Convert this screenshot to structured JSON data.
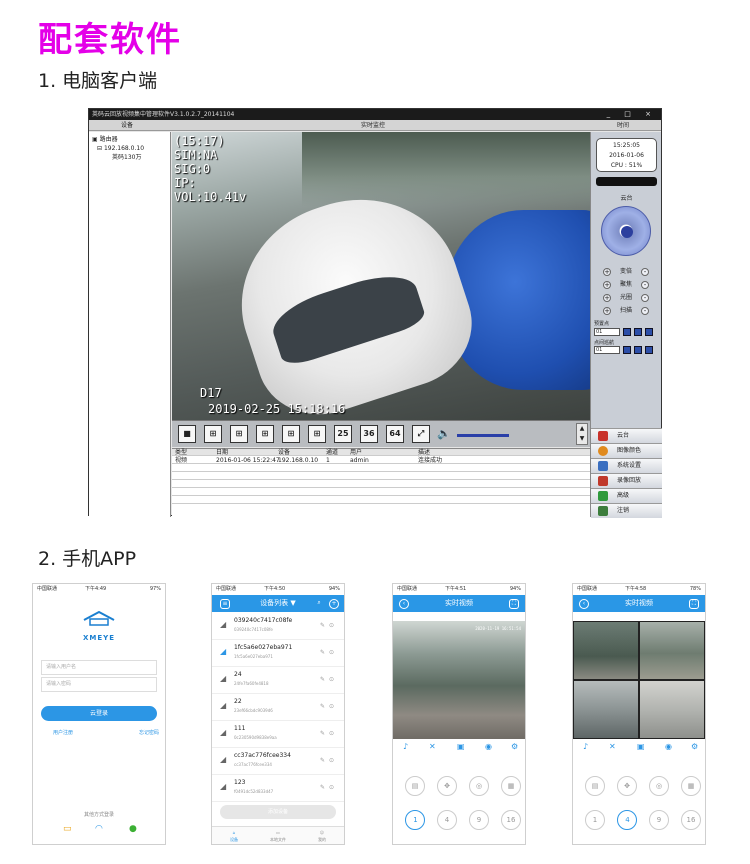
{
  "heading": "配套软件",
  "section1": "1. 电脑客户端",
  "section2": "2. 手机APP",
  "colors": {
    "heading": "#e400e8",
    "accent": "#2a97e6"
  },
  "pc": {
    "window_title": "英码云回放视频集中管理软件V3.1.0.2.7_20141104",
    "window_controls": "_ □ ×",
    "menu": [
      "设备",
      "实时监控",
      "时间"
    ],
    "tree": [
      "路由器",
      "192.168.0.10",
      "英码130万"
    ],
    "osd": {
      "time": "(15:17)",
      "sim": "SIM:NA",
      "sig": "SIG:0",
      "ip": "IP:",
      "vol": "VOL:10.41v",
      "channel": "D17",
      "timestamp": "2019-02-25 15:18:16"
    },
    "toolbar_counts": [
      "25",
      "36",
      "64"
    ],
    "log": {
      "headers": [
        "类型",
        "日期",
        "设备",
        "通道",
        "用户",
        "描述"
      ],
      "rows": [
        [
          "视频",
          "2016-01-06 15:22:47",
          "192.168.0.10",
          "1",
          "admin",
          "连接成功"
        ]
      ]
    },
    "clock": {
      "time": "15:25:05",
      "date": "2016-01-06",
      "cpu": "CPU : 51%"
    },
    "ptz": {
      "title": "云台",
      "rows": [
        "变倍",
        "聚焦",
        "光圈",
        "扫描"
      ],
      "preset_label": "预置点",
      "preset_value": "01",
      "cruise_label": "点间巡航",
      "cruise_value": "01"
    },
    "side_menu": [
      "云台",
      "图像颜色",
      "系统设置",
      "录像回放",
      "高级",
      "注销"
    ]
  },
  "phone1": {
    "status_left": "中国联通",
    "status_time": "下午4:49",
    "status_right": "97%",
    "logo": "XMEYE",
    "user_placeholder": "请输入用户名",
    "pass_placeholder": "请输入密码",
    "login": "云登录",
    "register": "用户注册",
    "forgot": "忘记密码",
    "other_login": "其他方式登录"
  },
  "phone2": {
    "status_left": "中国联通",
    "status_time": "下午4:50",
    "status_right": "94%",
    "title": "设备列表 ▼",
    "devices": [
      {
        "name": "039240c7417c08fe",
        "sub": "039240c7417c08fe"
      },
      {
        "name": "1fc5a6e027eba971",
        "sub": "1fc5a6e027eba971"
      },
      {
        "name": "24",
        "sub": "24fe7fa60fe4818"
      },
      {
        "name": "22",
        "sub": "23ef66cbdc9039d6"
      },
      {
        "name": "111",
        "sub": "0c230590d9838e9aa"
      },
      {
        "name": "cc37ac776fcee334",
        "sub": "cc37ac776fcee334"
      },
      {
        "name": "123",
        "sub": "f0491dc52d833d47"
      }
    ],
    "add_button": "添加设备",
    "tabs": [
      "设备",
      "本地文件",
      "我的"
    ]
  },
  "phone3": {
    "status_left": "中国联通",
    "status_time": "下午4:51",
    "status_right": "94%",
    "title": "实时视频",
    "timestamp": "2020-11-19 16:51:54",
    "channels": [
      "1",
      "4",
      "9",
      "16"
    ]
  },
  "phone4": {
    "status_left": "中国联通",
    "status_time": "下午4:58",
    "status_right": "78%",
    "title": "实时视频",
    "channels": [
      "1",
      "4",
      "9",
      "16"
    ]
  }
}
